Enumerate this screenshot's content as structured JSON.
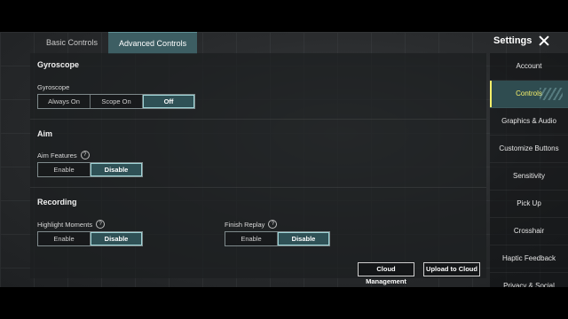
{
  "tabs": [
    "Basic Controls",
    "Advanced Controls"
  ],
  "header": {
    "title": "Settings"
  },
  "sidebar": {
    "items": [
      {
        "label": "Account"
      },
      {
        "label": "Controls"
      },
      {
        "label": "Graphics & Audio"
      },
      {
        "label": "Customize Buttons"
      },
      {
        "label": "Sensitivity"
      },
      {
        "label": "Pick Up"
      },
      {
        "label": "Crosshair"
      },
      {
        "label": "Haptic Feedback"
      },
      {
        "label": "Privacy & Social"
      }
    ],
    "selected": "Controls"
  },
  "sections": {
    "gyroscope": {
      "title": "Gyroscope",
      "label": "Gyroscope",
      "options": [
        "Always On",
        "Scope On",
        "Off"
      ],
      "selected": "Off"
    },
    "aim": {
      "title": "Aim",
      "label": "Aim Features",
      "options": [
        "Enable",
        "Disable"
      ],
      "selected": "Disable"
    },
    "recording": {
      "title": "Recording",
      "highlight": {
        "label": "Highlight Moments",
        "options": [
          "Enable",
          "Disable"
        ],
        "selected": "Disable"
      },
      "replay": {
        "label": "Finish Replay",
        "options": [
          "Enable",
          "Disable"
        ],
        "selected": "Disable"
      }
    }
  },
  "buttons": {
    "cloud_management": "Cloud Management",
    "upload": "Upload to Cloud"
  },
  "icons": {
    "help": "?",
    "close": "close-icon"
  },
  "colors": {
    "accent": "#2f5156",
    "active_text": "#f6f06a"
  }
}
